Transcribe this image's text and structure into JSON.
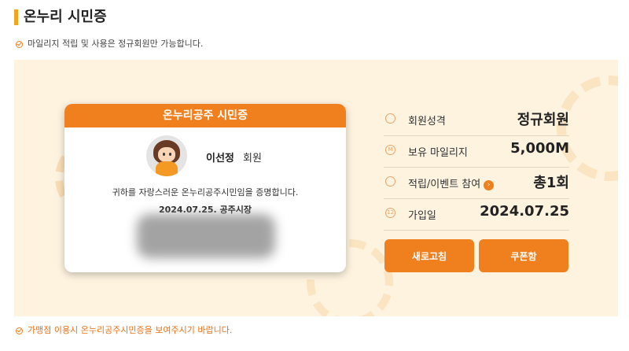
{
  "page": {
    "title": "온누리 시민증",
    "notice_top": "마일리지 적립 및 사용은 정규회원만 가능합니다.",
    "notice_bottom": "가맹점 이용시 온누리공주시민증을 보여주시기 바랍니다."
  },
  "card": {
    "header": "온누리공주 시민증",
    "member_name": "이선정",
    "member_suffix": "회원",
    "certify_text": "귀하를 자랑스러운 온누리공주시민임을 증명합니다.",
    "issue_line": "2024.07.25.  공주시장"
  },
  "info": [
    {
      "label": "회원성격",
      "value": "정규회원",
      "icon": "person-icon"
    },
    {
      "label": "보유 마일리지",
      "value": "5,000M",
      "icon": "mileage-icon"
    },
    {
      "label": "적립/이벤트 참여",
      "value": "총1회",
      "icon": "calendar-icon"
    },
    {
      "label": "가입일",
      "value": "2024.07.25",
      "icon": "calendar-date-icon"
    }
  ],
  "icons": {
    "mileage_glyph": "M",
    "date_glyph": "12",
    "more_glyph": "›"
  },
  "buttons": {
    "refresh": "새로고침",
    "coupon": "쿠폰함"
  },
  "colors": {
    "accent": "#f07f1e",
    "title_bar": "#f2a41e",
    "panel_bg": "#fdf3df"
  }
}
